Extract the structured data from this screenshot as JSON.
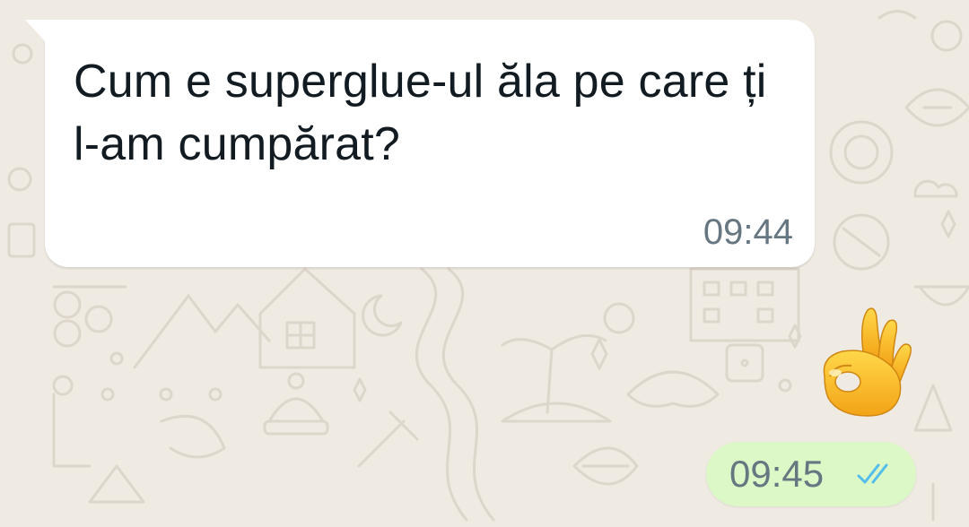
{
  "colors": {
    "background": "#efeae2",
    "pattern_stroke": "#ddd6cb",
    "incoming_bubble": "#ffffff",
    "outgoing_bubble": "#dcf8c6",
    "message_text": "#111b21",
    "timestamp_text": "#667781",
    "read_ticks": "#53bdeb"
  },
  "messages": [
    {
      "direction": "incoming",
      "text": "Cum e superglue-ul ăla pe care ți l-am cumpărat?",
      "time": "09:44"
    },
    {
      "direction": "outgoing",
      "emoji": "ok-hand-emoji",
      "time": "09:45",
      "status_icon": "double-check-read-icon"
    }
  ]
}
